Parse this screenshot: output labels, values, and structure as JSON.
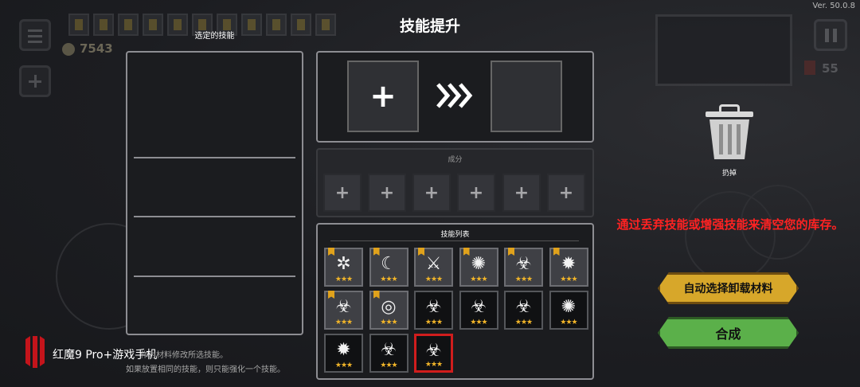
{
  "version": "Ver. 50.0.8",
  "title": "技能提升",
  "hud": {
    "gold": "7543",
    "hp": "55"
  },
  "left_panel": {
    "label": "选定的技能"
  },
  "upgrade": {
    "plus": "+",
    "arrow": "»»"
  },
  "ingredients": {
    "label": "成分",
    "slots": [
      "+",
      "+",
      "+",
      "+",
      "+",
      "+"
    ]
  },
  "skill_list": {
    "label": "技能列表",
    "items": [
      {
        "icon": "swirl-icon",
        "glyph": "✲",
        "stars": "★★★",
        "tag": true,
        "lit": true
      },
      {
        "icon": "moon-slash-icon",
        "glyph": "☾",
        "stars": "★★★",
        "tag": true,
        "lit": true
      },
      {
        "icon": "scythe-icon",
        "glyph": "⚔",
        "stars": "★★★",
        "tag": true,
        "lit": true
      },
      {
        "icon": "burst-icon",
        "glyph": "✺",
        "stars": "★★★",
        "tag": true,
        "lit": true
      },
      {
        "icon": "biohazard-icon",
        "glyph": "☣",
        "stars": "★★★",
        "tag": true,
        "lit": true
      },
      {
        "icon": "explosion-icon",
        "glyph": "✹",
        "stars": "★★★",
        "tag": true,
        "lit": true
      },
      {
        "icon": "biohazard-wings-icon",
        "glyph": "☣",
        "stars": "★★★",
        "tag": true,
        "lit": true
      },
      {
        "icon": "vortex-icon",
        "glyph": "◎",
        "stars": "★★★",
        "tag": true,
        "lit": true
      },
      {
        "icon": "biohazard-icon",
        "glyph": "☣",
        "stars": "★★★",
        "tag": false,
        "lit": false
      },
      {
        "icon": "biohazard-wings-icon",
        "glyph": "☣",
        "stars": "★★★",
        "tag": false,
        "lit": false
      },
      {
        "icon": "biohazard-wings-icon",
        "glyph": "☣",
        "stars": "★★★",
        "tag": false,
        "lit": false
      },
      {
        "icon": "burst-icon",
        "glyph": "✺",
        "stars": "★★★",
        "tag": false,
        "lit": false
      },
      {
        "icon": "explosion-icon",
        "glyph": "✹",
        "stars": "★★★",
        "tag": false,
        "lit": false
      },
      {
        "icon": "biohazard-wings-icon",
        "glyph": "☣",
        "stars": "★★★",
        "tag": false,
        "lit": false
      },
      {
        "icon": "biohazard-wings-icon",
        "glyph": "☣",
        "stars": "★★★",
        "tag": false,
        "lit": false,
        "selected": true
      }
    ]
  },
  "discard": {
    "label": "扔掉"
  },
  "hint": "通过丢弃技能或增强技能来清空您的库存。",
  "buttons": {
    "auto_select": "自动选择卸载材料",
    "combine": "合成"
  },
  "notes": {
    "line1": "作为材料修改所选技能。",
    "line2": "如果放置相同的技能，则只能强化一个技能。"
  },
  "brand": "红魔9 Pro+游戏手机",
  "colors": {
    "accent_gold": "#d7a72a",
    "accent_green": "#5bb04a",
    "hint_red": "#ff2222",
    "selected_red": "#d01d1d",
    "star": "#f0b429"
  }
}
